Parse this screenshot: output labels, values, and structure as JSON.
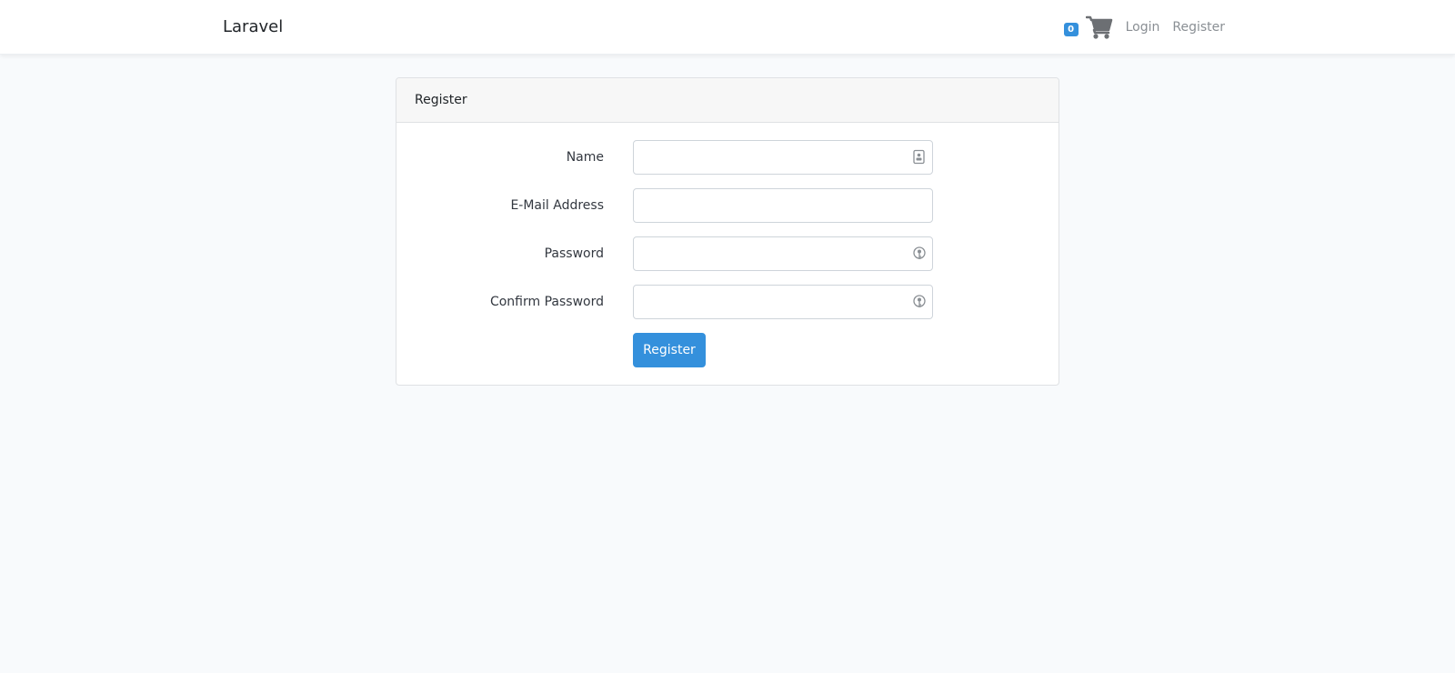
{
  "navbar": {
    "brand": "Laravel",
    "cart_count": "0",
    "cart_icon": "shopping-cart-icon",
    "links": [
      "Login",
      "Register"
    ]
  },
  "card": {
    "header": "Register",
    "fields": [
      {
        "label": "Name",
        "value": "",
        "icon": "contact-card-icon"
      },
      {
        "label": "E-Mail Address",
        "value": ""
      },
      {
        "label": "Password",
        "value": "",
        "icon": "key-icon"
      },
      {
        "label": "Confirm Password",
        "value": "",
        "icon": "key-icon"
      }
    ],
    "submit_label": "Register"
  },
  "colors": {
    "primary": "#3490dc",
    "background": "#f8fafc",
    "nav_link": "#8a8f94"
  }
}
